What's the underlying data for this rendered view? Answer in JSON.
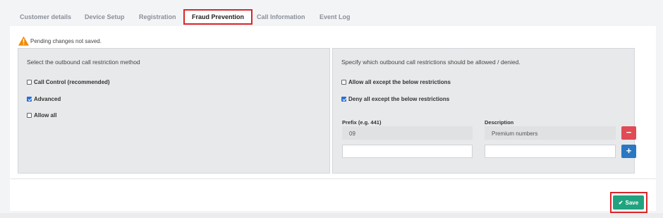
{
  "tabs": [
    {
      "label": "Customer details"
    },
    {
      "label": "Device Setup"
    },
    {
      "label": "Registration"
    },
    {
      "label": "Fraud Prevention"
    },
    {
      "label": "Call Information"
    },
    {
      "label": "Event Log"
    }
  ],
  "active_tab": "Fraud Prevention",
  "warning": {
    "icon": "warning-icon",
    "text": "Pending changes not saved.",
    "color": "#f08c00"
  },
  "left_panel": {
    "title": "Select the outbound call restriction method",
    "options": [
      {
        "label": "Call Control (recommended)",
        "checked": false
      },
      {
        "label": "Advanced",
        "checked": true
      },
      {
        "label": "Allow all",
        "checked": false
      }
    ]
  },
  "right_panel": {
    "title": "Specify which outbound call restrictions should be allowed / denied.",
    "options": [
      {
        "label": "Allow all except the below restrictions",
        "checked": false
      },
      {
        "label": "Deny all except the below restrictions",
        "checked": true
      }
    ],
    "prefix_label": "Prefix (e.g. 441)",
    "description_label": "Description",
    "rows": [
      {
        "prefix": "09",
        "description": "Premium numbers",
        "action": "−"
      },
      {
        "prefix": "",
        "description": "",
        "action": "+"
      }
    ]
  },
  "save": {
    "label": "Save",
    "icon": "check-icon",
    "color": "#21a37f"
  }
}
